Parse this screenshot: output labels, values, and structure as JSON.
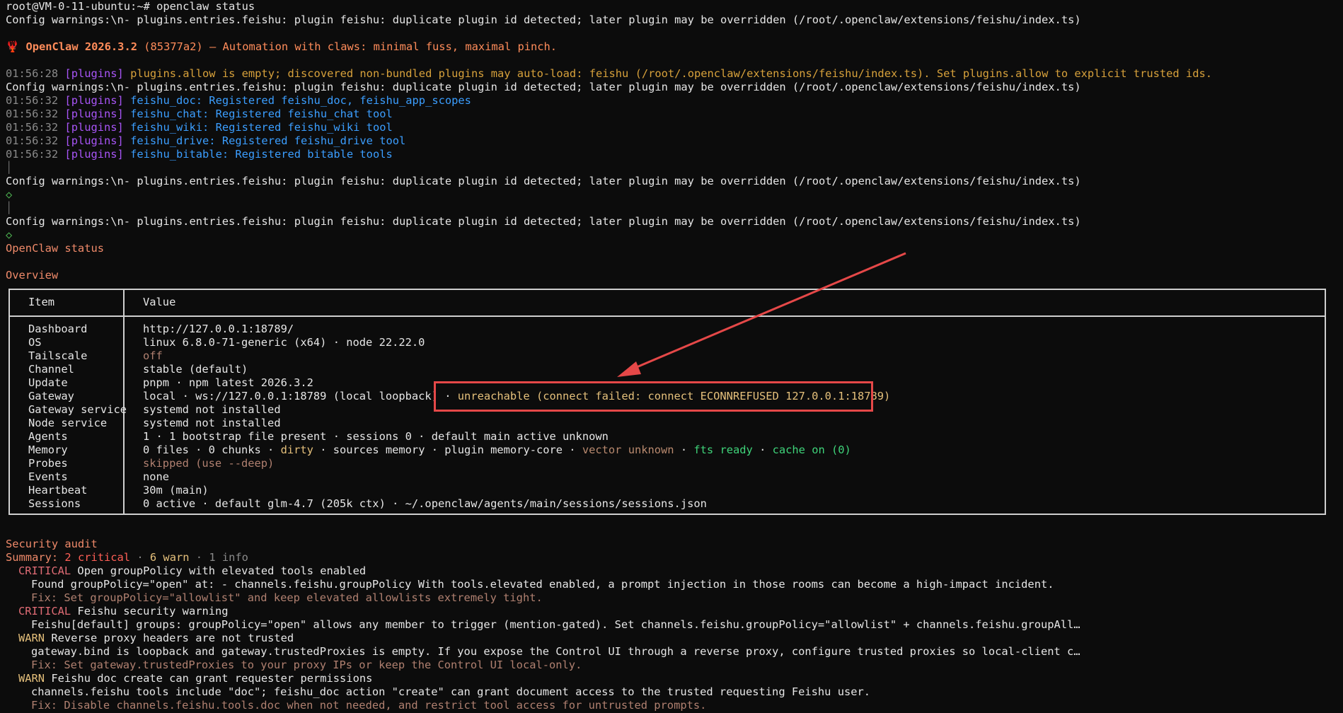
{
  "prompt": "root@VM-0-11-ubuntu:~# openclaw status",
  "config_warning": "Config warnings:\\n- plugins.entries.feishu: plugin feishu: duplicate plugin id detected; later plugin may be overridden (/root/.openclaw/extensions/feishu/index.ts)",
  "banner": {
    "icon": "🦞",
    "name": "OpenClaw 2026.3.2",
    "commit": "(85377a2)",
    "tagline": "— Automation with claws: minimal fuss, maximal pinch."
  },
  "logs": [
    {
      "time": "01:56:28",
      "tag": "[plugins]",
      "msg": "plugins.allow is empty; discovered non-bundled plugins may auto-load: feishu (/root/.openclaw/extensions/feishu/index.ts). Set plugins.allow to explicit trusted ids.",
      "color": "#d7a13b"
    },
    {
      "time": "01:56:32",
      "tag": "[plugins]",
      "msg": "feishu_doc: Registered feishu_doc, feishu_app_scopes",
      "color": "#3b9eff"
    },
    {
      "time": "01:56:32",
      "tag": "[plugins]",
      "msg": "feishu_chat: Registered feishu_chat tool",
      "color": "#3b9eff"
    },
    {
      "time": "01:56:32",
      "tag": "[plugins]",
      "msg": "feishu_wiki: Registered feishu_wiki tool",
      "color": "#3b9eff"
    },
    {
      "time": "01:56:32",
      "tag": "[plugins]",
      "msg": "feishu_drive: Registered feishu_drive tool",
      "color": "#3b9eff"
    },
    {
      "time": "01:56:32",
      "tag": "[plugins]",
      "msg": "feishu_bitable: Registered bitable tools",
      "color": "#3b9eff"
    }
  ],
  "pipe": "│",
  "diamond": "◇",
  "status_title": "OpenClaw status",
  "overview_title": "Overview",
  "table": {
    "header_item": "Item",
    "header_value": "Value",
    "rows": [
      {
        "item": "Dashboard",
        "value": "http://127.0.0.1:18789/"
      },
      {
        "item": "OS",
        "value": "linux 6.8.0-71-generic (x64) · node 22.22.0"
      },
      {
        "item": "Tailscale",
        "value": "off"
      },
      {
        "item": "Channel",
        "value": "stable (default)"
      },
      {
        "item": "Update",
        "value": "pnpm · npm latest 2026.3.2"
      },
      {
        "item": "Gateway",
        "value": "local · ws://127.0.0.1:18789 (local loopback) · ",
        "extra": "unreachable (connect failed: connect ECONNREFUSED 127.0.0.1:18789)"
      },
      {
        "item": "Gateway service",
        "value": "systemd not installed"
      },
      {
        "item": "Node service",
        "value": "systemd not installed"
      },
      {
        "item": "Agents",
        "value": "1 · 1 bootstrap file present · sessions 0 · default main active unknown"
      },
      {
        "item": "Memory",
        "parts": [
          "0 files · 0 chunks · ",
          "dirty",
          " · sources memory · plugin memory-core · ",
          "vector unknown",
          " · ",
          "fts ready",
          " · ",
          "cache on (0)"
        ]
      },
      {
        "item": "Probes",
        "value": "skipped (use --deep)"
      },
      {
        "item": "Events",
        "value": "none"
      },
      {
        "item": "Heartbeat",
        "value": "30m (main)"
      },
      {
        "item": "Sessions",
        "value": "0 active · default glm-4.7 (205k ctx) · ~/.openclaw/agents/main/sessions/sessions.json"
      }
    ]
  },
  "security": {
    "title": "Security audit",
    "summary_label": "Summary: ",
    "critical": "2 critical",
    "sep": " · ",
    "warn": "6 warn",
    "info": "1 info",
    "items": [
      {
        "level": "CRITICAL",
        "title": "Open groupPolicy with elevated tools enabled",
        "detail": "Found groupPolicy=\"open\" at: - channels.feishu.groupPolicy With tools.elevated enabled, a prompt injection in those rooms can become a high-impact incident.",
        "fix": "Fix: Set groupPolicy=\"allowlist\" and keep elevated allowlists extremely tight."
      },
      {
        "level": "CRITICAL",
        "title": "Feishu security warning",
        "detail": "Feishu[default] groups: groupPolicy=\"open\" allows any member to trigger (mention-gated). Set channels.feishu.groupPolicy=\"allowlist\" + channels.feishu.groupAll…",
        "fix": ""
      },
      {
        "level": "WARN",
        "title": "Reverse proxy headers are not trusted",
        "detail": "gateway.bind is loopback and gateway.trustedProxies is empty. If you expose the Control UI through a reverse proxy, configure trusted proxies so local-client c…",
        "fix": "Fix: Set gateway.trustedProxies to your proxy IPs or keep the Control UI local-only."
      },
      {
        "level": "WARN",
        "title": "Feishu doc create can grant requester permissions",
        "detail": "channels.feishu tools include \"doc\"; feishu_doc action \"create\" can grant document access to the trusted requesting Feishu user.",
        "fix": "Fix: Disable channels.feishu.tools.doc when not needed, and restrict tool access for untrusted prompts."
      }
    ]
  }
}
